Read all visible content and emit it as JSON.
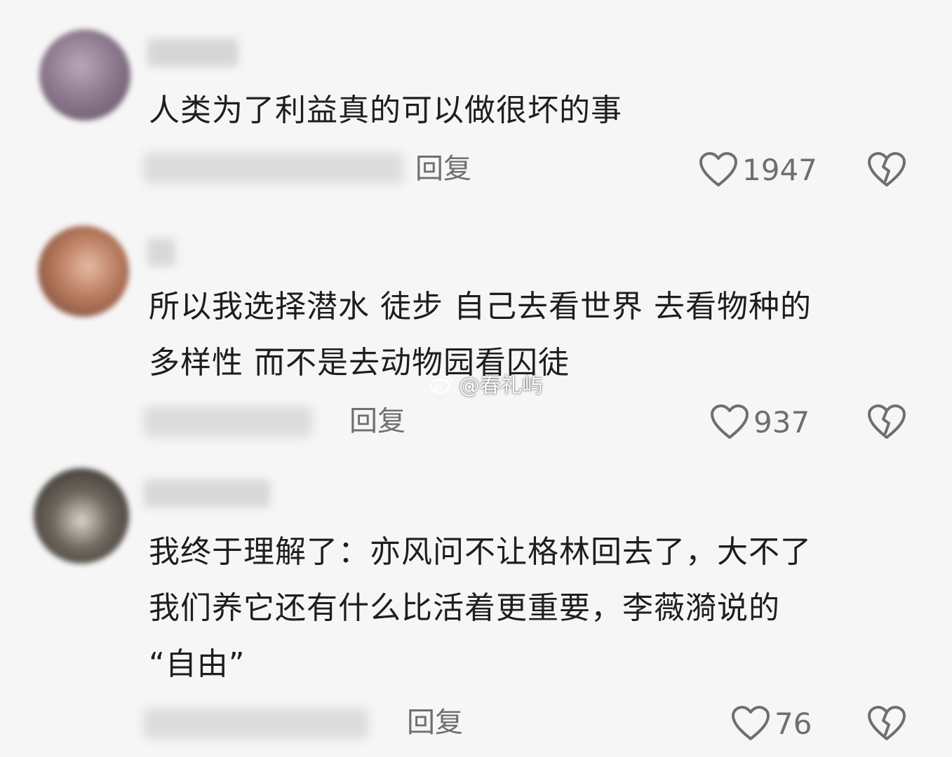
{
  "comments": [
    {
      "text": "人类为了利益真的可以做很坏的事",
      "reply_label": "回复",
      "like_count": "1947"
    },
    {
      "text": "所以我选择潜水 徒步 自己去看世界 去看物种的\n多样性 而不是去动物园看囚徒",
      "reply_label": "回复",
      "like_count": "937"
    },
    {
      "text": "我终于理解了：亦风问不让格林回去了，大不了\n我们养它还有什么比活着更重要，李薇漪说的\n“自由”",
      "reply_label": "回复",
      "like_count": "76"
    }
  ],
  "watermark": {
    "text": "@春礼屿",
    "icon": "weibo-icon"
  },
  "icons": {
    "like": "heart-outline-icon",
    "dislike": "broken-heart-icon"
  }
}
